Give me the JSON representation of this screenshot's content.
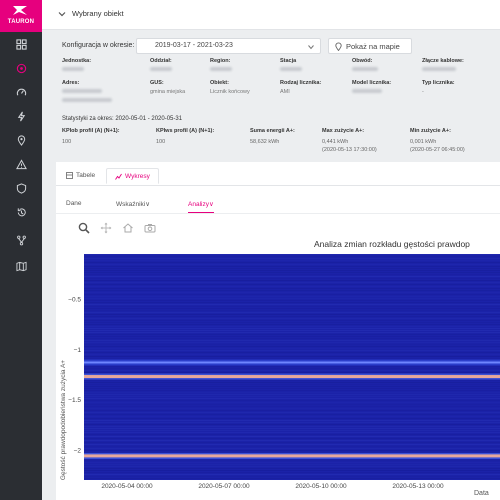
{
  "header": {
    "title": "Wybrany obiekt"
  },
  "config": {
    "label": "Konfiguracja w okresie:",
    "range": "2019-03-17 - 2021-03-23",
    "map_button": "Pokaż na mapie"
  },
  "info": {
    "row1": [
      {
        "label": "Jednostka:",
        "value": ""
      },
      {
        "label": "Oddział:",
        "value": ""
      },
      {
        "label": "Region:",
        "value": ""
      },
      {
        "label": "Stacja",
        "value": ""
      },
      {
        "label": "Obwód:",
        "value": ""
      },
      {
        "label": "Złącze kablowe:",
        "value": ""
      }
    ],
    "row2": [
      {
        "label": "Adres:",
        "value": ""
      },
      {
        "label": "GUS:",
        "value": "gmina miejska"
      },
      {
        "label": "Obiekt:",
        "value": "Licznik końcowy"
      },
      {
        "label": "Rodzaj licznika:",
        "value": "AMI"
      },
      {
        "label": "Model licznika:",
        "value": ""
      },
      {
        "label": "Typ licznika:",
        "value": "-"
      }
    ]
  },
  "stats": {
    "period": "Statystyki za okres: 2020-05-01 - 2020-05-31",
    "items": [
      {
        "label": "KPIob profil (A) (N+1):",
        "value": "100",
        "value2": ""
      },
      {
        "label": "KPIws profil (A) (N+1):",
        "value": "100",
        "value2": ""
      },
      {
        "label": "Suma energii A+:",
        "value": "58,632 kWh",
        "value2": ""
      },
      {
        "label": "Max zużycie A+:",
        "value": "0,441 kWh",
        "value2": "(2020-05-13 17:30:00)"
      },
      {
        "label": "Min zużycie A+:",
        "value": "0,001 kWh",
        "value2": "(2020-05-27 06:45:00)"
      }
    ]
  },
  "tabs": [
    "Tabele",
    "Wykresy"
  ],
  "active_tab": "Wykresy",
  "subtabs": [
    "Dane",
    "Wskaźniki",
    "Analizy"
  ],
  "active_subtab": "Analizy",
  "toolbar_icons": [
    "zoom-icon",
    "pan-icon",
    "home-icon",
    "camera-icon"
  ],
  "colors": {
    "brand": "#e6007e",
    "sidebar": "#2b2e33",
    "heat_base": "#1b22a8",
    "heat_hot": "#e8a89a"
  },
  "chart_data": {
    "type": "heatmap",
    "title": "Analiza zmian rozkładu gęstości prawdop",
    "xlabel": "Data",
    "ylabel": "Gęstość prawdopodobieństwa zużycia A+",
    "x_ticks": [
      "2020-05-04 00:00",
      "2020-05-07 00:00",
      "2020-05-10 00:00",
      "2020-05-13 00:00"
    ],
    "y_ticks": [
      "-0.5",
      "-1",
      "-1.5",
      "-2"
    ],
    "ylim": [
      -2.3,
      -0.05
    ],
    "bands": [
      {
        "y": -1.27,
        "intensity": "high"
      },
      {
        "y": -1.13,
        "intensity": "medium"
      },
      {
        "y": -2.06,
        "intensity": "high"
      }
    ]
  }
}
